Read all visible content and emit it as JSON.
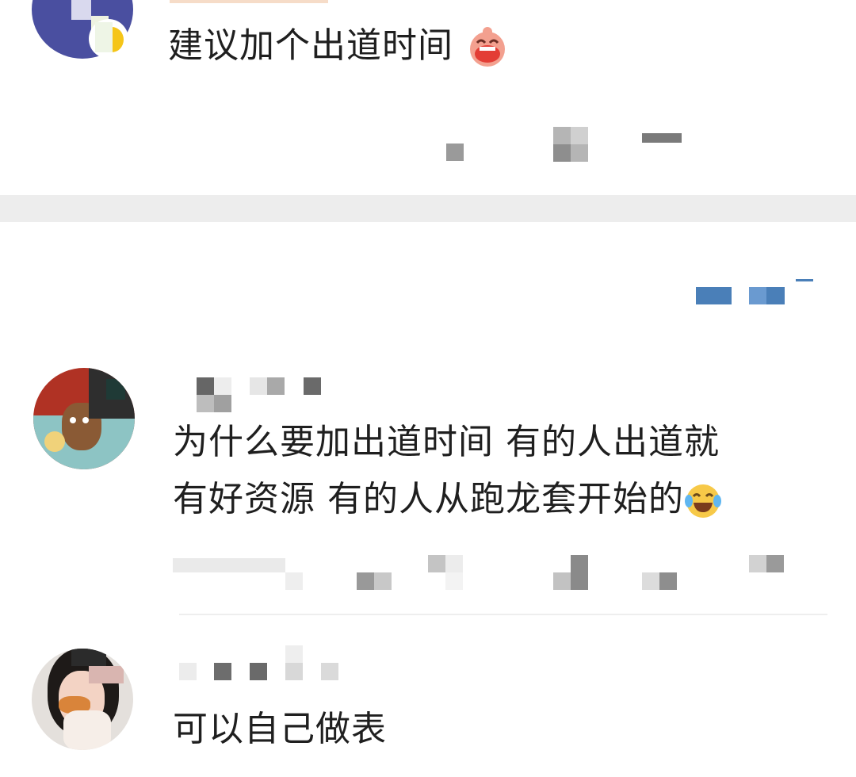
{
  "comments": [
    {
      "text": "建议加个出道时间",
      "emoji": "grinning-face-emoji"
    },
    {
      "line1": "为什么要加出道时间 有的人出道就",
      "line2": "有好资源 有的人从跑龙套开始的",
      "emoji": "tears-of-joy-emoji"
    },
    {
      "text": "可以自己做表"
    }
  ],
  "colors": {
    "accent": "#4a7fb8",
    "divider": "#ededed",
    "text": "#1f1f1f"
  }
}
